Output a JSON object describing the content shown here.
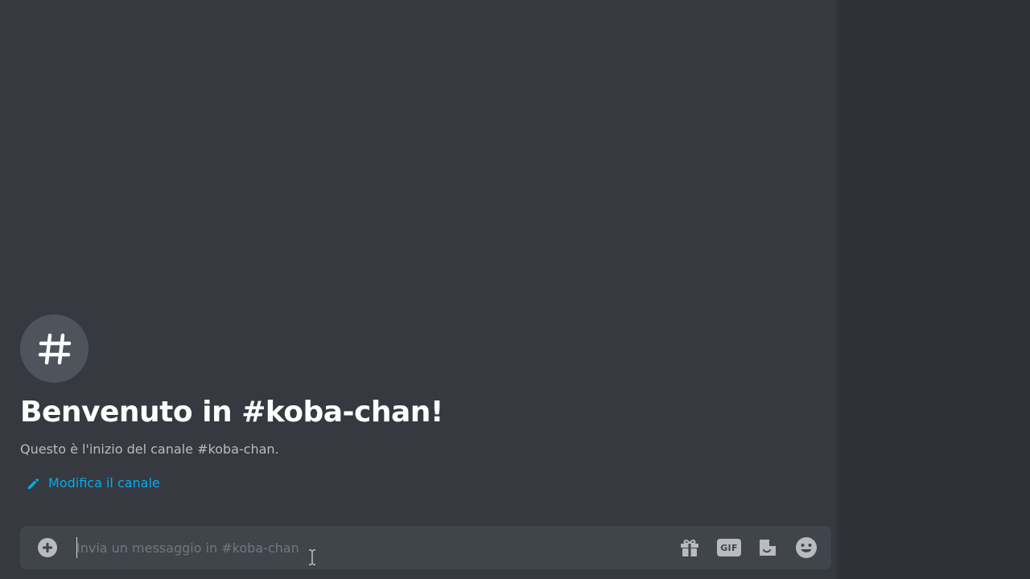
{
  "channel": {
    "icon": "hashtag-icon",
    "welcome_title": "Benvenuto in #koba-chan!",
    "welcome_subtitle": "Questo è l'inizio del canale #koba-chan.",
    "edit_label": "Modifica il canale",
    "edit_icon": "pencil-icon"
  },
  "composer": {
    "placeholder": "Invia un messaggio in #koba-chan",
    "value": "",
    "add_icon": "plus-circle-icon",
    "tools": [
      {
        "name": "gift-icon"
      },
      {
        "name": "gif-icon",
        "label": "GIF"
      },
      {
        "name": "sticker-icon"
      },
      {
        "name": "emoji-icon"
      }
    ]
  },
  "colors": {
    "chat_bg": "#36393f",
    "sidebar_bg": "#2f3136",
    "composer_bg": "#40444b",
    "link": "#00aff4",
    "title": "#ffffff",
    "muted": "#b9bbbe"
  }
}
